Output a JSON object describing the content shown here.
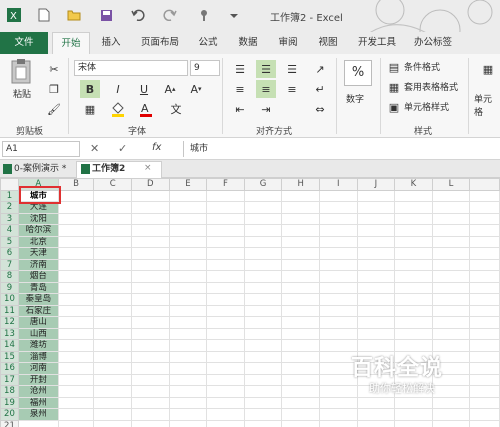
{
  "window": {
    "title": "工作簿2 - Excel"
  },
  "ribbon_tabs": [
    "文件",
    "开始",
    "插入",
    "页面布局",
    "公式",
    "数据",
    "审阅",
    "视图",
    "开发工具",
    "办公标签"
  ],
  "active_tab": "开始",
  "clipboard": {
    "paste_label": "粘贴",
    "group_label": "剪贴板"
  },
  "font": {
    "name": "宋体",
    "size": "9",
    "group_label": "字体",
    "bold": "B",
    "italic": "I",
    "underline": "U"
  },
  "alignment": {
    "group_label": "对齐方式"
  },
  "number": {
    "label": "数字",
    "symbol": "%"
  },
  "styles": {
    "group_label": "样式",
    "conditional_format": "条件格式",
    "table_format": "套用表格格式",
    "cell_styles": "单元格样式"
  },
  "cells_group": {
    "label": "单元格"
  },
  "formula_bar": {
    "name_box": "A1",
    "fx": "fx",
    "content": "城市"
  },
  "workbook_tabs": [
    {
      "label": "0-案例演示 *",
      "active": false
    },
    {
      "label": "工作簿2",
      "active": true
    }
  ],
  "columns": [
    "A",
    "B",
    "C",
    "D",
    "E",
    "F",
    "G",
    "H",
    "I",
    "J",
    "K",
    "L"
  ],
  "rows": [
    "1",
    "2",
    "3",
    "4",
    "5",
    "6",
    "7",
    "8",
    "9",
    "10",
    "11",
    "12",
    "13",
    "14",
    "15",
    "16",
    "17",
    "18",
    "19",
    "20",
    "21"
  ],
  "column_a": [
    "城市",
    "大连",
    "沈阳",
    "哈尔滨",
    "北京",
    "天津",
    "济南",
    "烟台",
    "青岛",
    "秦皇岛",
    "石家庄",
    "唐山",
    "山西",
    "潍坊",
    "淄博",
    "河南",
    "开封",
    "沧州",
    "福州",
    "泉州"
  ],
  "watermark": {
    "title": "百科全说",
    "subtitle": "助你轻松解决"
  },
  "colors": {
    "accent": "#217346",
    "selection": "#a7cbb3",
    "highlight_box": "#e03131"
  }
}
